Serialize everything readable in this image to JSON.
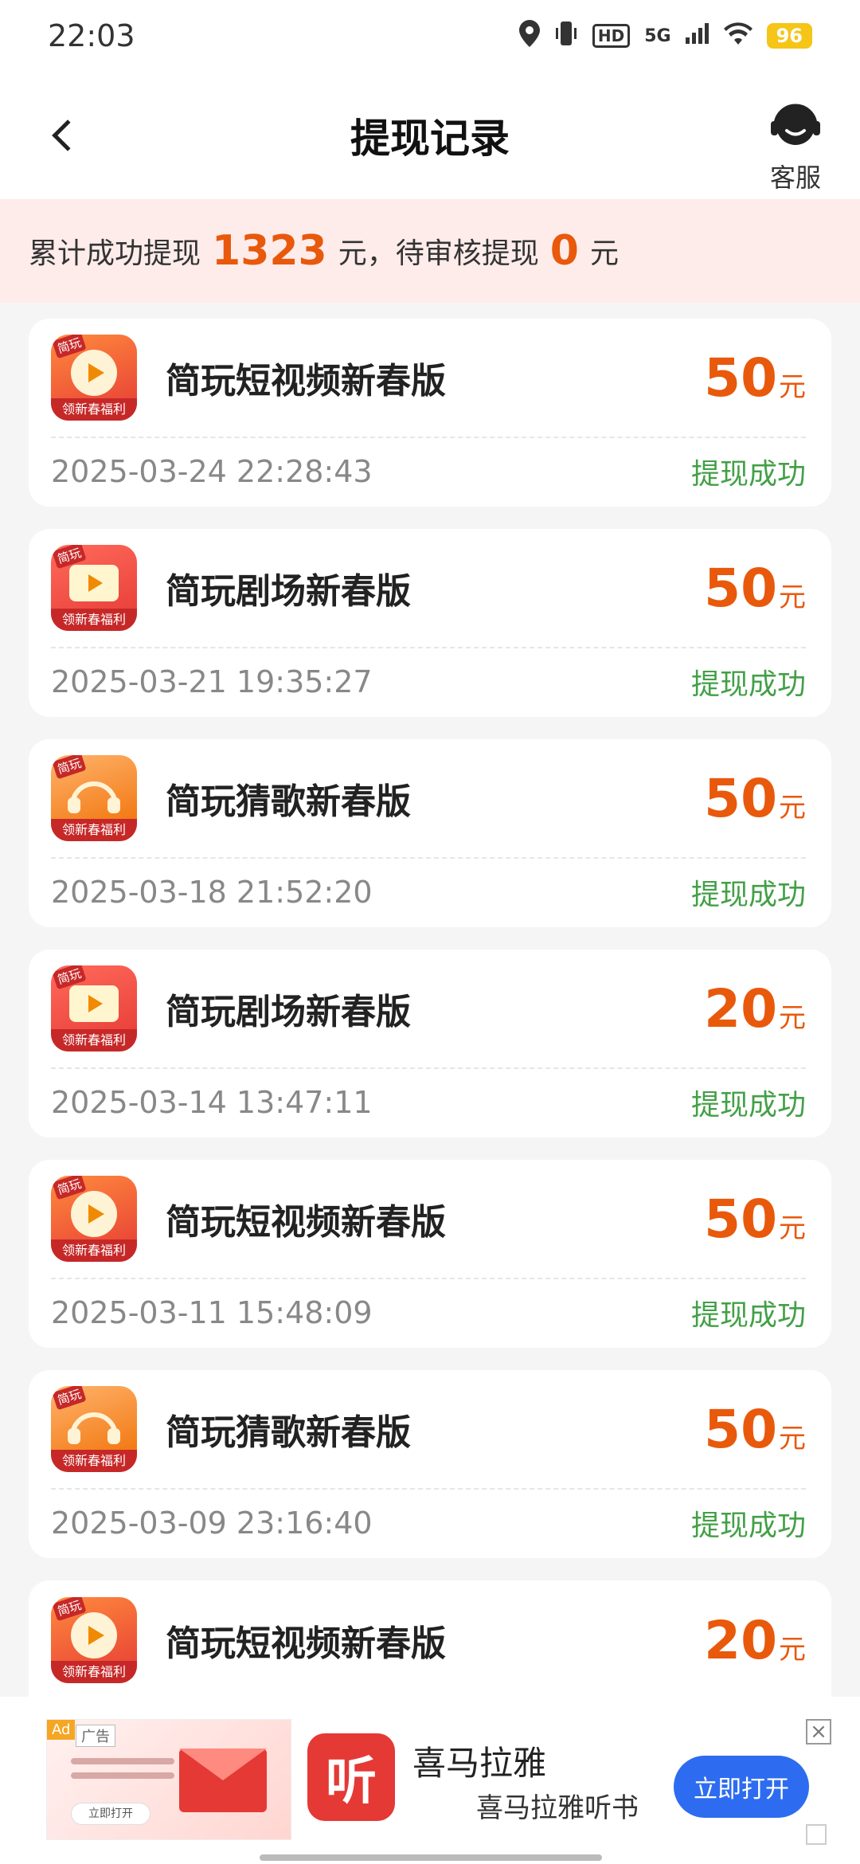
{
  "status_bar": {
    "time": "22:03",
    "hd": "HD",
    "network": "5G",
    "battery": "96"
  },
  "header": {
    "title": "提现记录",
    "service_label": "客服"
  },
  "summary": {
    "prefix": "累计成功提现",
    "total": "1323",
    "middle": "元，待审核提现",
    "pending": "0",
    "suffix": "元"
  },
  "app_icon_text": {
    "tag": "简玩",
    "ribbon": "领新春福利"
  },
  "records": [
    {
      "app": "简玩短视频新春版",
      "icon": "video",
      "amount": "50",
      "unit": "元",
      "time": "2025-03-24 22:28:43",
      "status": "提现成功"
    },
    {
      "app": "简玩剧场新春版",
      "icon": "drama",
      "amount": "50",
      "unit": "元",
      "time": "2025-03-21 19:35:27",
      "status": "提现成功"
    },
    {
      "app": "简玩猜歌新春版",
      "icon": "song",
      "amount": "50",
      "unit": "元",
      "time": "2025-03-18 21:52:20",
      "status": "提现成功"
    },
    {
      "app": "简玩剧场新春版",
      "icon": "drama",
      "amount": "20",
      "unit": "元",
      "time": "2025-03-14 13:47:11",
      "status": "提现成功"
    },
    {
      "app": "简玩短视频新春版",
      "icon": "video",
      "amount": "50",
      "unit": "元",
      "time": "2025-03-11 15:48:09",
      "status": "提现成功"
    },
    {
      "app": "简玩猜歌新春版",
      "icon": "song",
      "amount": "50",
      "unit": "元",
      "time": "2025-03-09 23:16:40",
      "status": "提现成功"
    },
    {
      "app": "简玩短视频新春版",
      "icon": "video",
      "amount": "20",
      "unit": "元",
      "time": "",
      "status": ""
    }
  ],
  "ad": {
    "tag": "Ad",
    "label": "广告",
    "mini_button": "立即打开",
    "logo_char": "听",
    "title": "喜马拉雅",
    "subtitle": "喜马拉雅听书",
    "open_button": "立即打开",
    "close": "×"
  }
}
